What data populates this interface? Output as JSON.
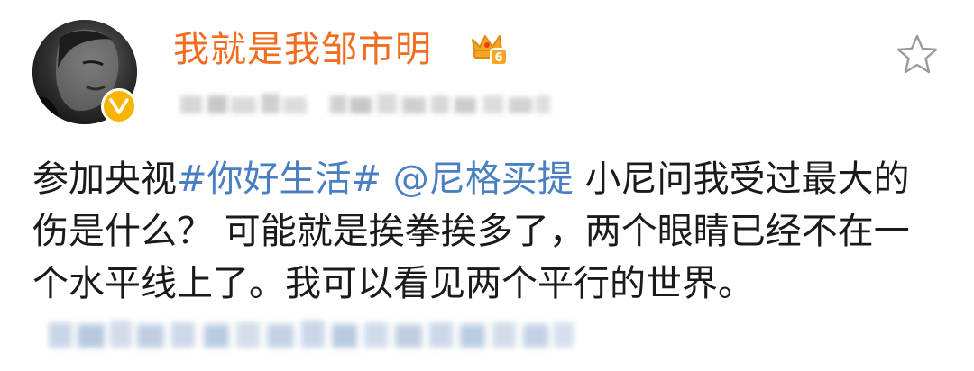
{
  "author": {
    "name": "我就是我邹市明",
    "vip_level": "6",
    "verified_icon": "v-badge-icon",
    "vip_icon": "crown-icon"
  },
  "post": {
    "text_before_topic": "参加央视",
    "topic": "#你好生活#",
    "mention": "@尼格买提",
    "text_after": "小尼问我受过最大的伤是什么？ 可能就是挨拳挨多了，两个眼睛已经不在一个水平线上了。我可以看见两个平行的世界。"
  },
  "colors": {
    "username": "#f26d1f",
    "link": "#4a7fc1",
    "verified_badge": "#f7b500",
    "body_text": "#1a1a1a"
  }
}
